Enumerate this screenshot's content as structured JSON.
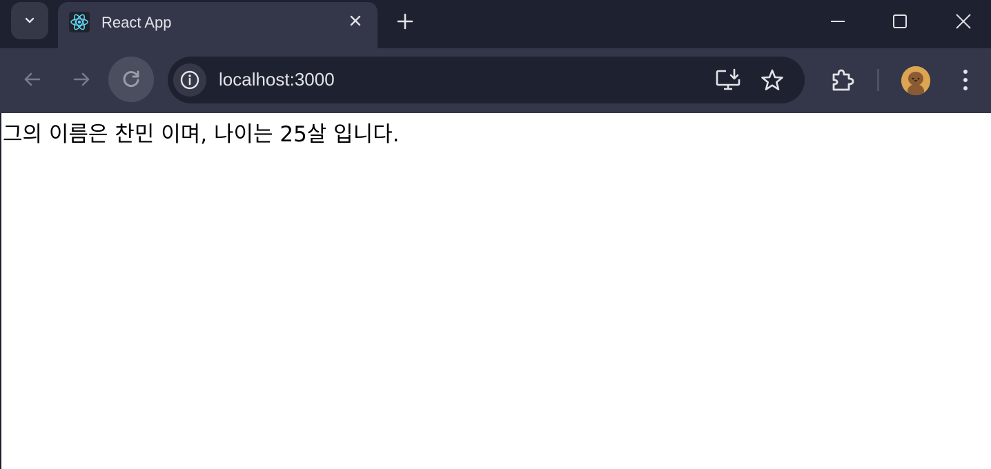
{
  "tab": {
    "title": "React App",
    "favicon": "react-logo-icon"
  },
  "toolbar": {
    "url": "localhost:3000"
  },
  "page": {
    "text": "그의 이름은 찬민 이며, 나이는 25살 입니다."
  },
  "colors": {
    "tab_strip_bg": "#1e2130",
    "toolbar_bg": "#34374a",
    "omnibox_bg": "#1e2130",
    "react_blue": "#61dafb",
    "page_bg": "#ffffff"
  }
}
